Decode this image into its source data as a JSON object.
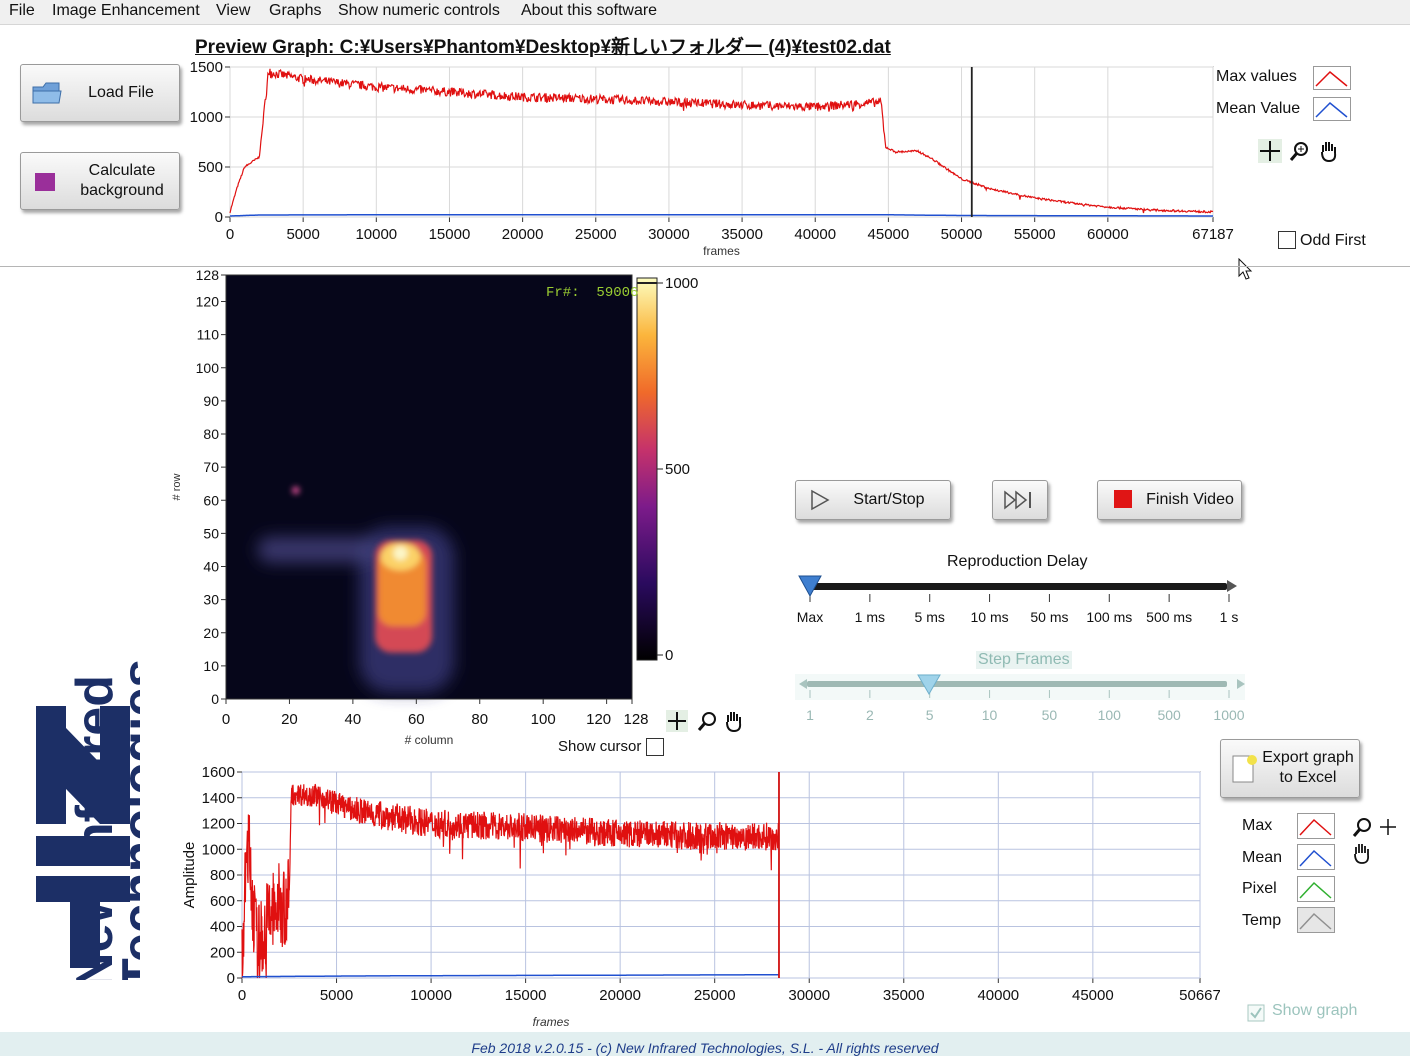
{
  "menu": [
    "File",
    "Image Enhancement",
    "View",
    "Graphs",
    "Show numeric controls",
    "About this software"
  ],
  "preview": {
    "title": "Preview Graph: C:¥Users¥Phantom¥Desktop¥新しいフォルダー (4)¥test02.dat",
    "load_button": "Load File",
    "calc_button": "Calculate background",
    "legend": [
      "Max values",
      "Mean Value"
    ],
    "odd_first_label": "Odd First",
    "icons": [
      "crosshair-icon",
      "zoom-icon",
      "hand-icon"
    ]
  },
  "image_view": {
    "frame_label": "Fr#:",
    "frame_value": "59006",
    "show_cursor_label": "Show cursor",
    "colorbar_ticks": [
      "1000",
      "500",
      "0"
    ]
  },
  "logo": {
    "line1": "New Infrared",
    "line2": "Technologies",
    "mark": "NIT"
  },
  "controls": {
    "start_stop": "Start/Stop",
    "finish_video": "Finish Video",
    "delay_title": "Reproduction Delay",
    "delay_ticks": [
      "Max",
      "1 ms",
      "5 ms",
      "10 ms",
      "50 ms",
      "100 ms",
      "500 ms",
      "1 s"
    ],
    "step_title": "Step Frames",
    "step_ticks": [
      "1",
      "2",
      "5",
      "10",
      "50",
      "100",
      "500",
      "1000"
    ],
    "delay_value": "Max",
    "step_value": "5"
  },
  "bottom_panel": {
    "export_button": "Export graph to Excel",
    "legend": [
      "Max",
      "Mean",
      "Pixel",
      "Temp"
    ],
    "show_graph_label": "Show graph"
  },
  "footer": "Feb 2018 v.2.0.15 - (c) New Infrared Technologies, S.L. - All rights reserved",
  "colors": {
    "max": "#e01010",
    "mean": "#2050d0",
    "pixel": "#30b030",
    "temp": "#909090",
    "logo": "#1c2f66"
  },
  "chart_data": [
    {
      "type": "line",
      "title": "",
      "xlabel": "frames",
      "ylabel": "",
      "xlim": [
        0,
        67187
      ],
      "ylim": [
        0,
        1500
      ],
      "x_ticks": [
        "0",
        "5000",
        "10000",
        "15000",
        "20000",
        "25000",
        "30000",
        "35000",
        "40000",
        "45000",
        "50000",
        "55000",
        "60000",
        "67187"
      ],
      "y_ticks": [
        "0",
        "500",
        "1000",
        "1500"
      ],
      "cursor_x": 50700,
      "series": [
        {
          "name": "Max values",
          "x": [
            0,
            500,
            1000,
            2000,
            2300,
            2600,
            5000,
            10000,
            15000,
            20000,
            25000,
            30000,
            35000,
            40000,
            44500,
            44800,
            45500,
            47000,
            48000,
            50000,
            52000,
            55000,
            58000,
            60000,
            63000,
            67187
          ],
          "y": [
            50,
            300,
            500,
            600,
            1000,
            1450,
            1380,
            1300,
            1250,
            1200,
            1180,
            1150,
            1120,
            1100,
            1150,
            700,
            650,
            660,
            580,
            380,
            280,
            190,
            130,
            100,
            70,
            50
          ]
        },
        {
          "name": "Mean Value",
          "x": [
            0,
            2000,
            10000,
            45000,
            50000,
            67187
          ],
          "y": [
            10,
            20,
            22,
            22,
            15,
            10
          ]
        }
      ]
    },
    {
      "type": "line",
      "title": "",
      "xlabel": "frames",
      "ylabel": "Amplitude",
      "xlim": [
        0,
        50667
      ],
      "ylim": [
        0,
        1600
      ],
      "x_ticks": [
        "0",
        "5000",
        "10000",
        "15000",
        "20000",
        "25000",
        "30000",
        "35000",
        "40000",
        "45000",
        "50667"
      ],
      "y_ticks": [
        "0",
        "200",
        "400",
        "600",
        "800",
        "1000",
        "1200",
        "1400",
        "1600"
      ],
      "cursor_x": 28400,
      "series": [
        {
          "name": "Max",
          "x": [
            0,
            300,
            800,
            1500,
            2500,
            2600,
            4000,
            6000,
            10000,
            15000,
            20000,
            25000,
            28400
          ],
          "y": [
            100,
            1100,
            200,
            500,
            600,
            1430,
            1420,
            1300,
            1200,
            1170,
            1120,
            1100,
            1100
          ]
        },
        {
          "name": "Mean",
          "x": [
            0,
            5000,
            10000,
            15000,
            20000,
            25000,
            28400
          ],
          "y": [
            10,
            15,
            18,
            20,
            22,
            24,
            25
          ]
        }
      ]
    },
    {
      "type": "heatmap",
      "xlabel": "# column",
      "ylabel": "# row",
      "xlim": [
        0,
        128
      ],
      "ylim": [
        0,
        128
      ],
      "x_ticks": [
        "0",
        "20",
        "40",
        "60",
        "80",
        "100",
        "120",
        "128"
      ],
      "y_ticks": [
        "0",
        "10",
        "20",
        "30",
        "40",
        "50",
        "60",
        "70",
        "80",
        "90",
        "100",
        "110",
        "120",
        "128"
      ],
      "colorbar_range": [
        0,
        1000
      ]
    }
  ]
}
